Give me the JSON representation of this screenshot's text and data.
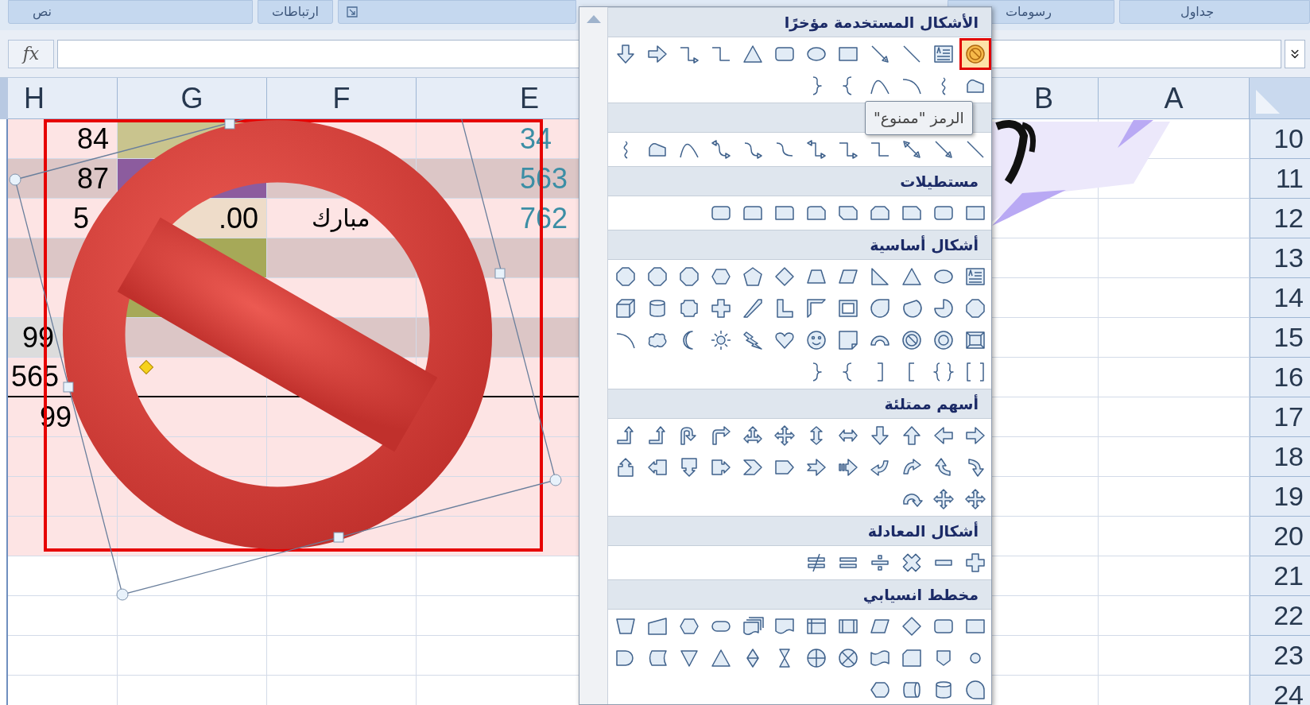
{
  "ribbon": {
    "groups": [
      {
        "label": "جداول"
      },
      {
        "label": "رسومات"
      },
      {
        "label": "ارتباطات"
      },
      {
        "label": "نص"
      }
    ]
  },
  "formula_bar": {
    "function_button": "fx"
  },
  "sheet": {
    "columns_right": [
      "A",
      "B"
    ],
    "columns_left": [
      "E",
      "F",
      "G",
      "H"
    ],
    "rows": [
      {
        "number": "10",
        "cells": {
          "col_h": "84",
          "col_e": "34"
        }
      },
      {
        "number": "11",
        "cells": {
          "col_h": "87",
          "col_e": "563"
        }
      },
      {
        "number": "12",
        "cells": {
          "col_h": "5",
          "col_g": ".00",
          "col_f": "مبارك",
          "col_e": "762"
        }
      },
      {
        "number": "13"
      },
      {
        "number": "14"
      },
      {
        "number": "15",
        "cells": {
          "col_h": "99"
        }
      },
      {
        "number": "16",
        "cells": {
          "col_h": "565"
        }
      },
      {
        "number": "17",
        "cells": {
          "col_h": "99"
        }
      },
      {
        "number": "18"
      },
      {
        "number": "19"
      },
      {
        "number": "20"
      },
      {
        "number": "21"
      },
      {
        "number": "22"
      },
      {
        "number": "23"
      },
      {
        "number": "24"
      }
    ]
  },
  "shapes_menu": {
    "sections": [
      {
        "kind": "recent",
        "title": "الأشكال المستخدمة مؤخرًا",
        "items": [
          {
            "selected": true
          },
          {
            "selected": false
          },
          {
            "selected": false
          },
          {
            "selected": false
          },
          {
            "selected": false
          },
          {
            "selected": false
          },
          {
            "selected": false
          },
          {
            "selected": false
          },
          {
            "selected": false
          },
          {
            "selected": false
          },
          {
            "selected": false
          },
          {
            "selected": false
          },
          {
            "selected": false
          },
          {
            "selected": false
          },
          {
            "selected": false
          },
          {
            "selected": false
          },
          {
            "selected": false
          },
          {
            "selected": false
          }
        ]
      },
      {
        "kind": "lines"
      },
      {
        "kind": "rectangles",
        "title": "مستطيلات"
      },
      {
        "kind": "basic",
        "title": "أشكال أساسية"
      },
      {
        "kind": "arrows",
        "title": "أسهم ممتلئة"
      },
      {
        "kind": "equation",
        "title": "أشكال المعادلة"
      },
      {
        "kind": "flowchart",
        "title": "مخطط انسيابي"
      }
    ],
    "tooltip": "الرمز \"ممنوع\""
  }
}
